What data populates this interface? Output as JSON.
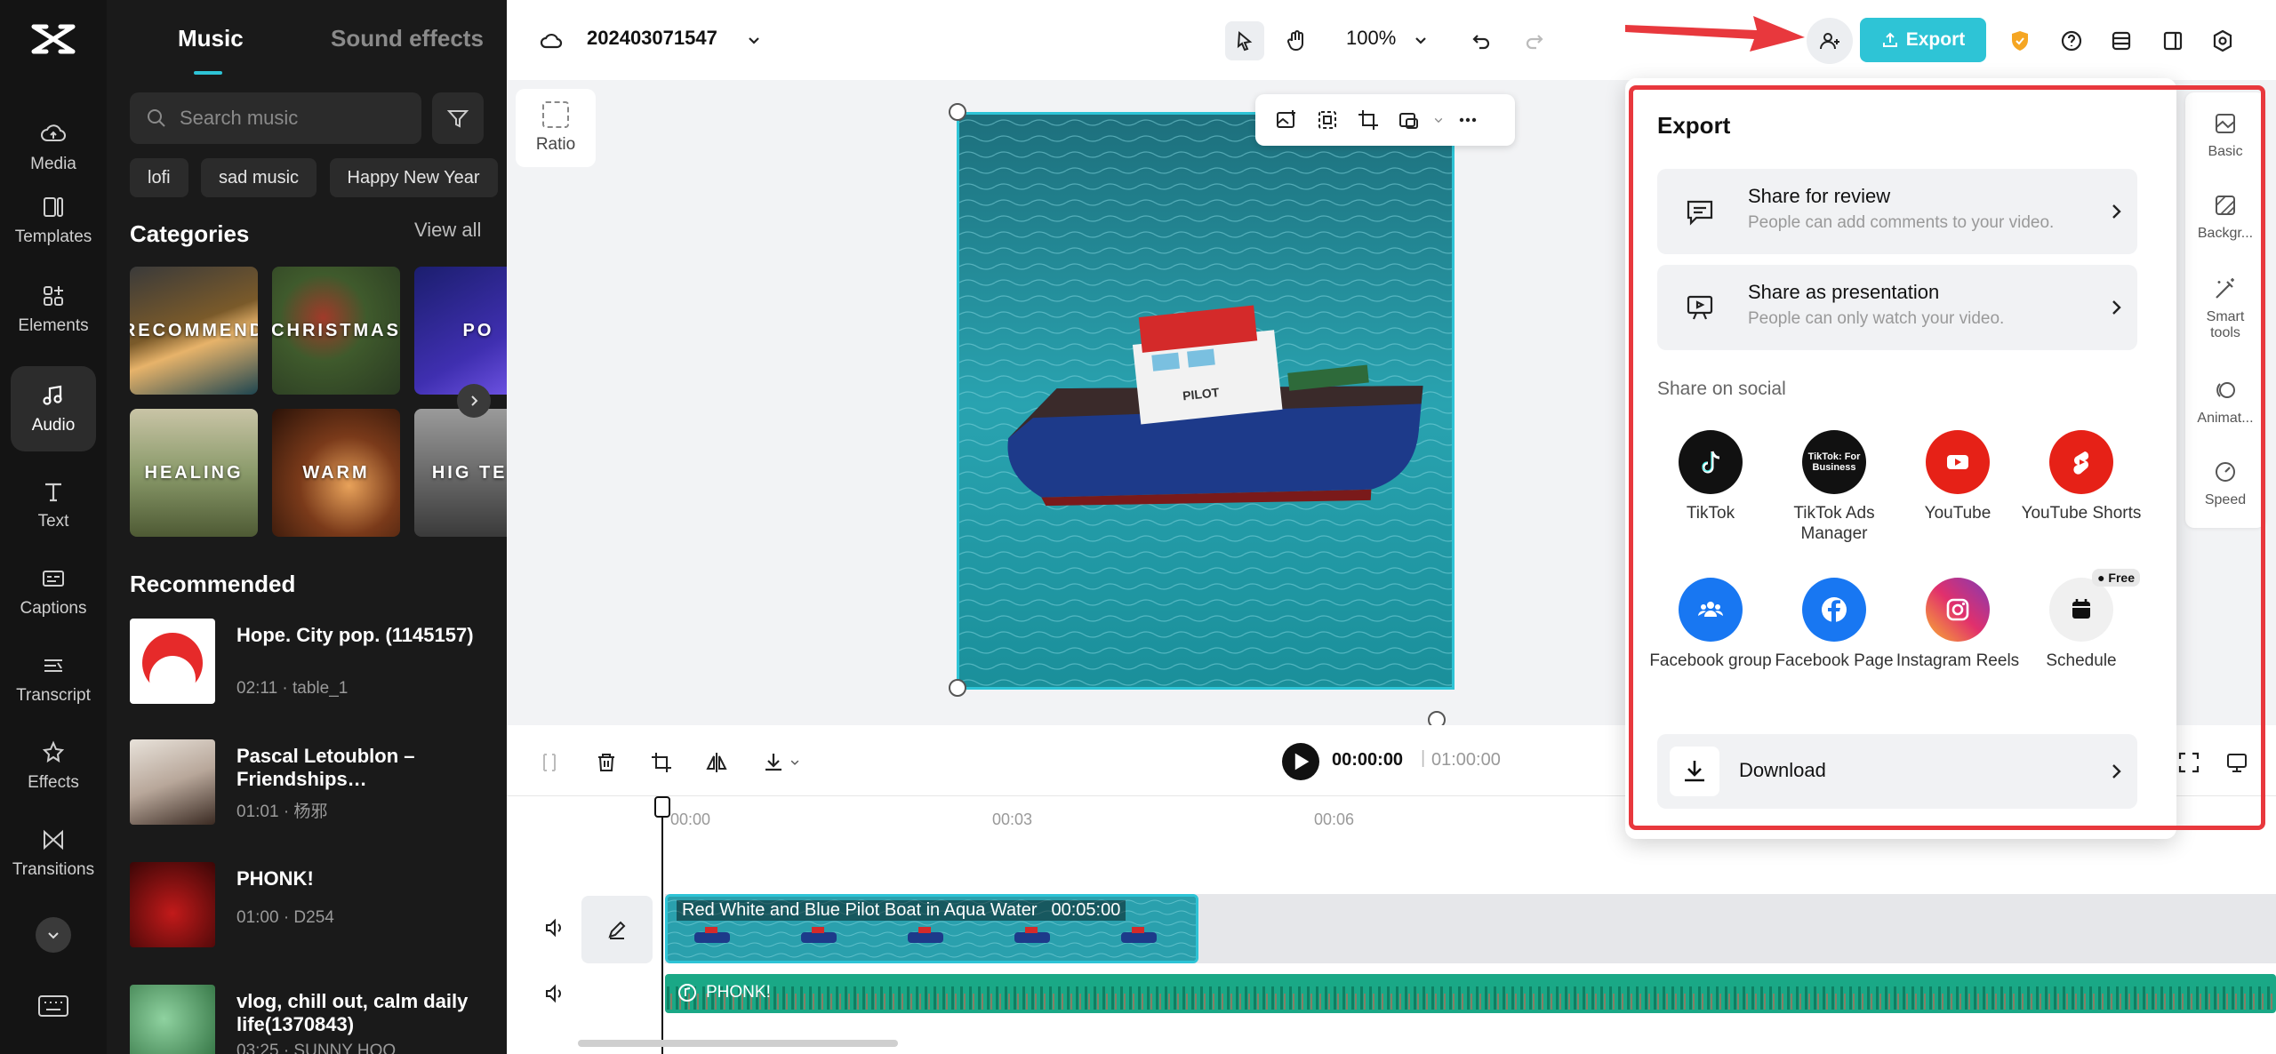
{
  "rail": {
    "items": [
      {
        "label": "Media",
        "icon": "cloud-upload-icon"
      },
      {
        "label": "Templates",
        "icon": "templates-icon"
      },
      {
        "label": "Elements",
        "icon": "elements-icon"
      },
      {
        "label": "Audio",
        "icon": "music-note-icon"
      },
      {
        "label": "Text",
        "icon": "text-icon"
      },
      {
        "label": "Captions",
        "icon": "captions-icon"
      },
      {
        "label": "Transcript",
        "icon": "transcript-icon"
      },
      {
        "label": "Effects",
        "icon": "effects-icon"
      },
      {
        "label": "Transitions",
        "icon": "transitions-icon"
      }
    ]
  },
  "panel": {
    "tabs": {
      "music": "Music",
      "sfx": "Sound effects"
    },
    "search_placeholder": "Search music",
    "chips": [
      "lofi",
      "sad music",
      "Happy New Year"
    ],
    "categories_title": "Categories",
    "view_all": "View all",
    "categories": [
      "RECOMMEND",
      "CHRISTMAS",
      "PO",
      "HEALING",
      "WARM",
      "HIG TEM"
    ],
    "recommended_title": "Recommended",
    "tracks": [
      {
        "title": "Hope. City pop. (1145157)",
        "meta": "02:11 · table_1"
      },
      {
        "title": "Pascal Letoublon – Friendships…",
        "meta": "01:01 · 杨邪"
      },
      {
        "title": "PHONK!",
        "meta": "01:00 · D254"
      },
      {
        "title": "vlog, chill out, calm daily life(1370843)",
        "meta": "03:25 · SUNNY HOO"
      }
    ]
  },
  "topbar": {
    "project_name": "202403071547",
    "zoom": "100%",
    "export_label": "Export"
  },
  "canvas": {
    "ratio_label": "Ratio"
  },
  "props": [
    {
      "label": "Basic"
    },
    {
      "label": "Backgr..."
    },
    {
      "label": "Smart tools"
    },
    {
      "label": "Animat..."
    },
    {
      "label": "Speed"
    }
  ],
  "controls": {
    "current_time": "00:00:00",
    "separator": "|",
    "total_time": "01:00:00"
  },
  "timeline": {
    "ruler": [
      "00:00",
      "00:03",
      "00:06"
    ],
    "video_clip": {
      "name": "Red White and Blue Pilot Boat in Aqua Water",
      "duration": "00:05:00"
    },
    "audio_clip": "PHONK!"
  },
  "export": {
    "title": "Export",
    "share_review": {
      "title": "Share for review",
      "subtitle": "People can add comments to your video."
    },
    "share_presentation": {
      "title": "Share as presentation",
      "subtitle": "People can only watch your video."
    },
    "social_label": "Share on social",
    "social": [
      {
        "label": "TikTok",
        "color": "#111111"
      },
      {
        "label": "TikTok Ads Manager",
        "color": "#111111"
      },
      {
        "label": "YouTube",
        "color": "#e62117"
      },
      {
        "label": "YouTube Shorts",
        "color": "#e62117"
      },
      {
        "label": "Facebook group",
        "color": "#1877f2"
      },
      {
        "label": "Facebook Page",
        "color": "#1877f2"
      },
      {
        "label": "Instagram Reels",
        "color": "#d62976"
      },
      {
        "label": "Schedule",
        "color": "#f0f0f0",
        "badge": "Free"
      }
    ],
    "tiktok_ads_logo": "TikTok: For Business",
    "download_label": "Download"
  },
  "colors": {
    "accent": "#2ec4d6",
    "highlight": "#e8383d",
    "audio_track": "#1aa886"
  }
}
